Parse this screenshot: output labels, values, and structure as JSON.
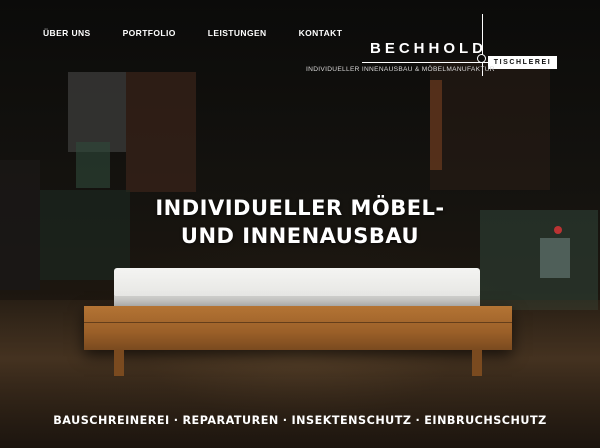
{
  "nav": {
    "items": [
      {
        "label": "ÜBER UNS"
      },
      {
        "label": "PORTFOLIO"
      },
      {
        "label": "LEISTUNGEN"
      },
      {
        "label": "KONTAKT"
      }
    ]
  },
  "logo": {
    "name": "BECHHOLD",
    "subtitle": "TISCHLEREI",
    "tagline": "INDIVIDUELLER INNENAUSBAU & MÖBELMANUFAKTUR"
  },
  "hero": {
    "headline_line1": "INDIVIDUELLER MÖBEL-",
    "headline_line2": "UND INNENAUSBAU"
  },
  "services": {
    "items": [
      "BAUSCHREINEREI",
      "REPARATUREN",
      "INSEKTENSCHUTZ",
      "EINBRUCHSCHUTZ"
    ],
    "separator": "·"
  }
}
